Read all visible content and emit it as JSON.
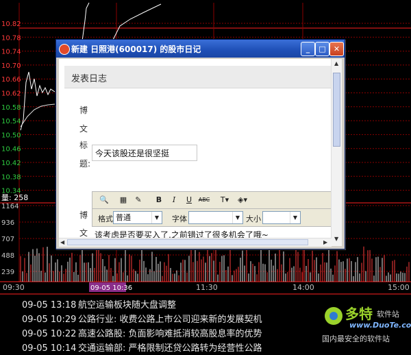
{
  "chart": {
    "price_ticks": [
      "10.82",
      "10.78",
      "10.74",
      "10.70",
      "10.66",
      "10.62",
      "10.58",
      "10.54",
      "10.50",
      "10.46",
      "10.42",
      "10.38",
      "10.34"
    ],
    "volume_ticks": [
      "1164",
      "936",
      "707",
      "488",
      "239"
    ],
    "volume_label": "量: 258",
    "time_ticks": [
      "09:30",
      "11:30",
      "14:00",
      "15:00"
    ],
    "cursor_time": "09-05 10:36"
  },
  "news": [
    {
      "time": "09-05 13:18",
      "text": "航空运输板块随大盘调整"
    },
    {
      "time": "09-05 10:29",
      "text": "公路行业: 收费公路上市公司迎来新的发展契机"
    },
    {
      "time": "09-05 10:22",
      "text": "高速公路股: 负面影响难抵消较高股息率的优势"
    },
    {
      "time": "09-05 10:14",
      "text": "交通运输部: 严格限制还贷公路转为经营性公路"
    }
  ],
  "watermark": {
    "brand": "多特",
    "suffix": "软件站",
    "url": "www.DuoTe.com",
    "tagline": "国内最安全的软件站"
  },
  "dialog": {
    "title": "新建 日照港(600017) 的股市日记",
    "page_title": "发表日志",
    "label_title": [
      "博",
      "文",
      "标",
      "题:"
    ],
    "label_body": [
      "博",
      "文"
    ],
    "title_value": "今天该股还是很坚挺",
    "format_label": "格式",
    "format_value": "普通",
    "font_label": "字体",
    "font_value": "",
    "size_label": "大小",
    "size_value": "",
    "body_value": "该考虑是否要买入了,之前错过了很多机会了哦~"
  },
  "colors": {
    "titlebar": "#1f4fb6",
    "grid": "#8b0000",
    "price_line": "#ffffff",
    "volume": "#ffffff"
  }
}
